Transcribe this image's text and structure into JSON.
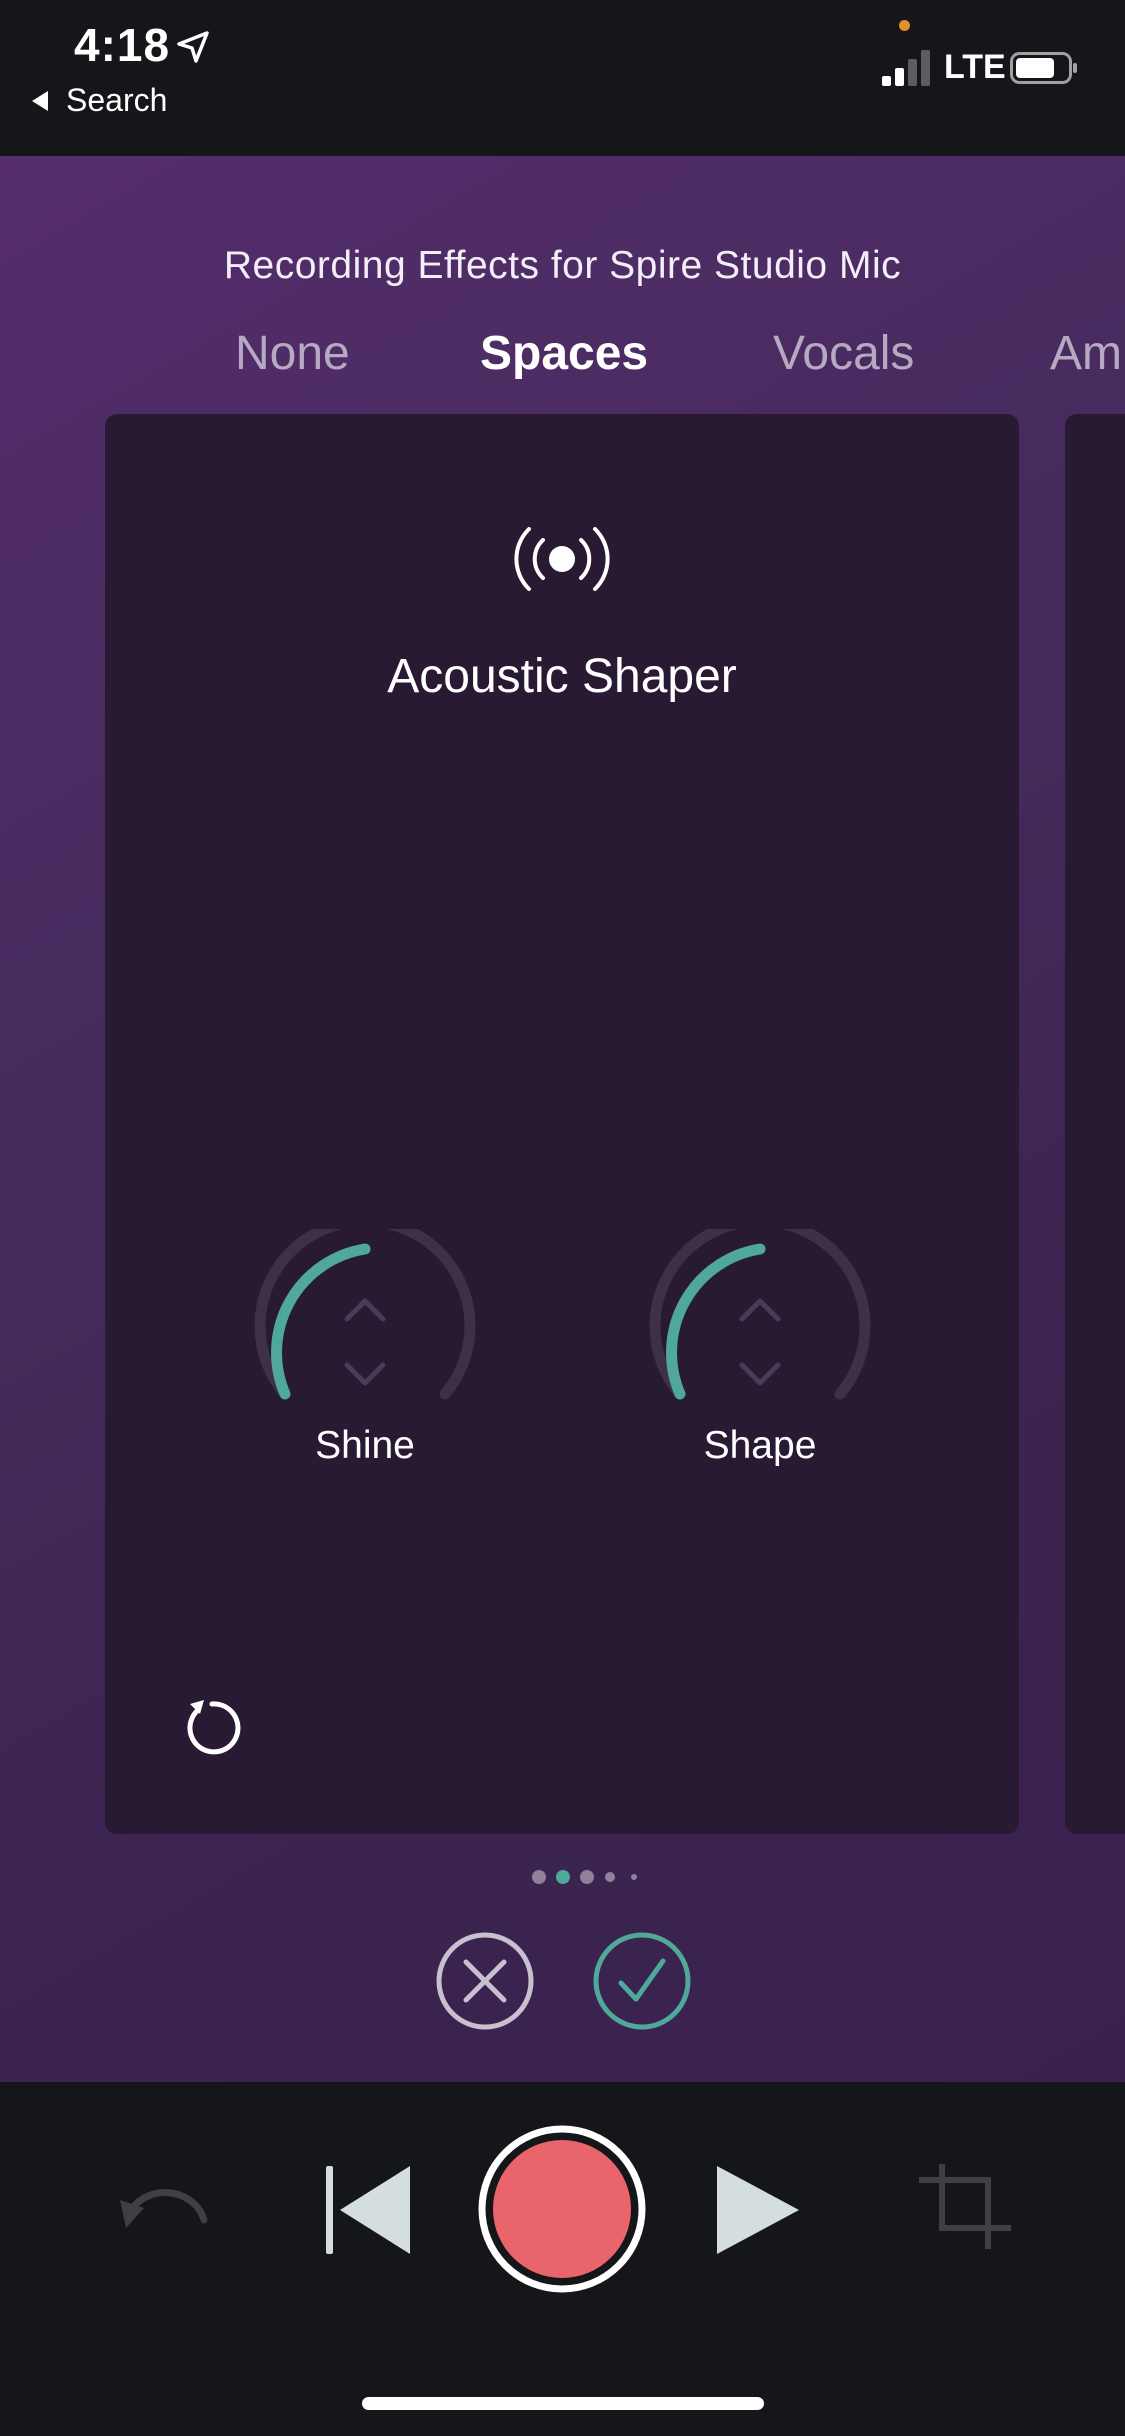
{
  "status_bar": {
    "time": "4:18",
    "back_label": "Search",
    "network": "LTE",
    "icons": [
      "location-arrow-icon",
      "signal-icon",
      "battery-icon"
    ]
  },
  "panel": {
    "title": "Recording Effects for Spire Studio Mic",
    "tabs": [
      {
        "label": "None",
        "active": false
      },
      {
        "label": "Spaces",
        "active": true
      },
      {
        "label": "Vocals",
        "active": false
      },
      {
        "label": "Amp",
        "active": false
      }
    ]
  },
  "effect": {
    "icon": "broadcast-icon",
    "name": "Acoustic Shaper",
    "knobs": [
      {
        "label": "Shine",
        "level": 0.5
      },
      {
        "label": "Shape",
        "level": 0.5
      }
    ]
  },
  "pagination": {
    "count": 5,
    "active_index": 1
  },
  "actions": {
    "cancel_icon": "close-icon",
    "confirm_icon": "check-icon"
  },
  "transport": {
    "icons": [
      "undo-icon",
      "skip-back-icon",
      "record-icon",
      "play-icon",
      "crop-icon"
    ]
  },
  "colors": {
    "accent": "#4fa89a",
    "record": "#ea646c",
    "panel_gradient_start": "#552d6c",
    "panel_gradient_end": "#3b2150",
    "card": "#291a34",
    "track": "#3f3049"
  }
}
